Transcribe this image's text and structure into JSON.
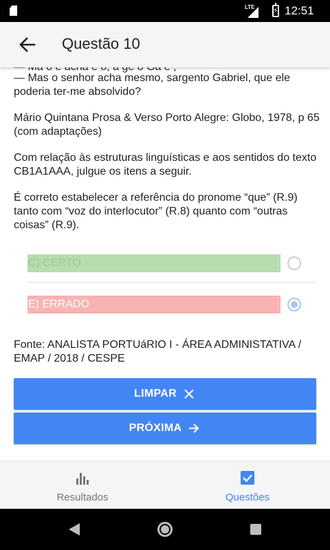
{
  "status_bar": {
    "network": "LTE",
    "time": "12:51"
  },
  "app_bar": {
    "title": "Questão 10",
    "back_icon": "arrow-back-icon"
  },
  "question": {
    "cut_line": "— Ma  o   e    acha     e o,    a ge   o  Ga  e ,      ",
    "lines": [
      "— Mas o senhor acha mesmo, sargento Gabriel, que ele poderia ter-me absolvido?",
      "Mário Quintana Prosa & Verso Porto Alegre: Globo, 1978, p 65 (com adaptações)",
      "Com relação às estruturas linguísticas e aos sentidos do texto CB1A1AAA, julgue os itens a seguir.",
      "É correto estabelecer a referência do pronome “que” (R.9) tanto com “voz do interlocutor” (R.8) quanto com “outras coisas” (R.9)."
    ]
  },
  "options": [
    {
      "label": "C) CERTO",
      "color": "#b6dcb0",
      "selected": false
    },
    {
      "label": "E) ERRADO",
      "color": "#f8b3b3",
      "selected": true
    }
  ],
  "source": "Fonte: ANALISTA PORTUáRIO I - ÁREA ADMINISTATIVA / EMAP / 2018 / CESPE",
  "buttons": {
    "clear_label": "LIMPAR",
    "clear_icon": "close-icon",
    "next_label": "PRÓXIMA",
    "next_icon": "arrow-forward-icon",
    "color": "#4286f4"
  },
  "bottom_nav": {
    "items": [
      {
        "label": "Resultados",
        "icon": "bar-chart-icon",
        "active": false
      },
      {
        "label": "Questões",
        "icon": "checkbox-icon",
        "active": true
      }
    ],
    "active_color": "#4286f4"
  }
}
